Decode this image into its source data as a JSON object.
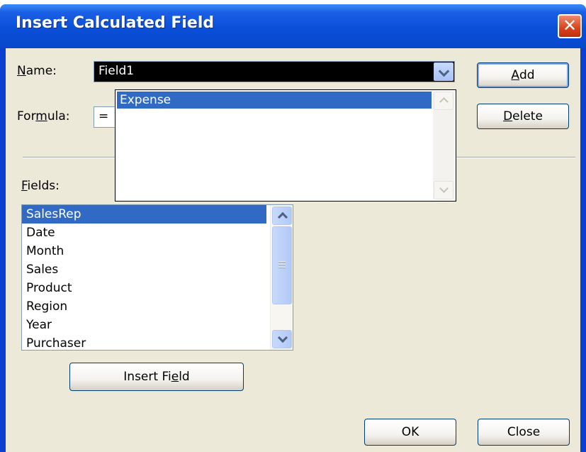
{
  "dialog": {
    "title": "Insert Calculated Field",
    "close_glyph": "✕"
  },
  "name": {
    "label_mnemonic": "N",
    "label_rest": "ame:",
    "value": "Field1"
  },
  "formula": {
    "label_pre": "For",
    "label_mnemonic": "m",
    "label_post": "ula:",
    "value": "="
  },
  "dropdown": {
    "items": [
      "Expense"
    ]
  },
  "buttons": {
    "add_mnemonic": "A",
    "add_rest": "dd",
    "delete_mnemonic": "D",
    "delete_rest": "elete",
    "insert_field_pre": "Insert Fi",
    "insert_field_mnemonic": "e",
    "insert_field_post": "ld",
    "ok": "OK",
    "close": "Close"
  },
  "fields": {
    "label_mnemonic": "F",
    "label_rest": "ields:",
    "items": [
      "SalesRep",
      "Date",
      "Month",
      "Sales",
      "Product",
      "Region",
      "Year",
      "Purchaser"
    ],
    "selected_index": 0
  },
  "colors": {
    "titlebar": "#0a4fd8",
    "dialog_bg": "#ece9d8",
    "selection": "#316ac5",
    "close_button": "#d8421c"
  }
}
